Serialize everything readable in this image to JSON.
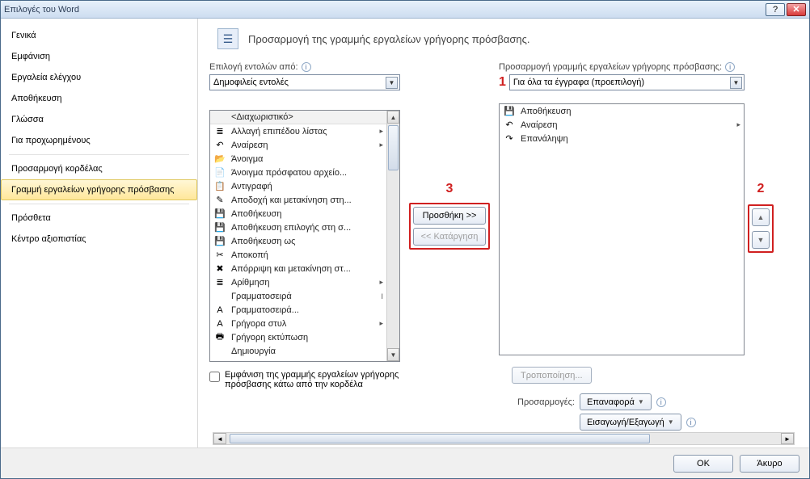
{
  "window": {
    "title": "Επιλογές του Word"
  },
  "sidebar": {
    "items": [
      {
        "label": "Γενικά"
      },
      {
        "label": "Εμφάνιση"
      },
      {
        "label": "Εργαλεία ελέγχου"
      },
      {
        "label": "Αποθήκευση"
      },
      {
        "label": "Γλώσσα"
      },
      {
        "label": "Για προχωρημένους"
      },
      {
        "label": "Προσαρμογή κορδέλας"
      },
      {
        "label": "Γραμμή εργαλείων γρήγορης πρόσβασης"
      },
      {
        "label": "Πρόσθετα"
      },
      {
        "label": "Κέντρο αξιοπιστίας"
      }
    ],
    "selectedIndex": 7
  },
  "header": {
    "text": "Προσαρμογή της γραμμής εργαλείων γρήγορης πρόσβασης."
  },
  "chooseFrom": {
    "label": "Επιλογή εντολών από:",
    "value": "Δημοφιλείς εντολές"
  },
  "customizeQAT": {
    "label": "Προσαρμογή γραμμής εργαλείων γρήγορης πρόσβασης:",
    "value": "Για όλα τα έγγραφα (προεπιλογή)"
  },
  "availableCommands": [
    {
      "icon": "",
      "text": "<Διαχωριστικό>",
      "fly": ""
    },
    {
      "icon": "≣",
      "text": "Αλλαγή επιπέδου λίστας",
      "fly": "▸"
    },
    {
      "icon": "↶",
      "text": "Αναίρεση",
      "fly": "▸"
    },
    {
      "icon": "📂",
      "text": "Άνοιγμα",
      "fly": ""
    },
    {
      "icon": "📄",
      "text": "Άνοιγμα πρόσφατου αρχείο...",
      "fly": ""
    },
    {
      "icon": "📋",
      "text": "Αντιγραφή",
      "fly": ""
    },
    {
      "icon": "✎",
      "text": "Αποδοχή και μετακίνηση στη...",
      "fly": ""
    },
    {
      "icon": "💾",
      "text": "Αποθήκευση",
      "fly": ""
    },
    {
      "icon": "💾",
      "text": "Αποθήκευση επιλογής στη σ...",
      "fly": ""
    },
    {
      "icon": "💾",
      "text": "Αποθήκευση ως",
      "fly": ""
    },
    {
      "icon": "✂",
      "text": "Αποκοπή",
      "fly": ""
    },
    {
      "icon": "✖",
      "text": "Απόρριψη και μετακίνηση στ...",
      "fly": ""
    },
    {
      "icon": "≣",
      "text": "Αρίθμηση",
      "fly": "▸"
    },
    {
      "icon": "",
      "text": "Γραμματοσειρά",
      "fly": "I"
    },
    {
      "icon": "A",
      "text": "Γραμματοσειρά...",
      "fly": ""
    },
    {
      "icon": "A",
      "text": "Γρήγορα στυλ",
      "fly": "▸"
    },
    {
      "icon": "🖶",
      "text": "Γρήγορη εκτύπωση",
      "fly": ""
    },
    {
      "icon": "",
      "text": "Δημιουργία",
      "fly": ""
    }
  ],
  "qatCommands": [
    {
      "icon": "💾",
      "text": "Αποθήκευση",
      "fly": ""
    },
    {
      "icon": "↶",
      "text": "Αναίρεση",
      "fly": "▸"
    },
    {
      "icon": "↷",
      "text": "Επανάληψη",
      "fly": ""
    }
  ],
  "buttons": {
    "add": "Προσθήκη >>",
    "remove": "<< Κατάργηση",
    "modify": "Τροποποίηση...",
    "reset": "Επαναφορά",
    "importExport": "Εισαγωγή/Εξαγωγή",
    "ok": "OK",
    "cancel": "Άκυρο"
  },
  "labels": {
    "showBelowRibbon": "Εμφάνιση της γραμμής εργαλείων γρήγορης πρόσβασης κάτω από την κορδέλα",
    "customizations": "Προσαρμογές:"
  },
  "annotations": {
    "one": "1",
    "two": "2",
    "three": "3"
  }
}
